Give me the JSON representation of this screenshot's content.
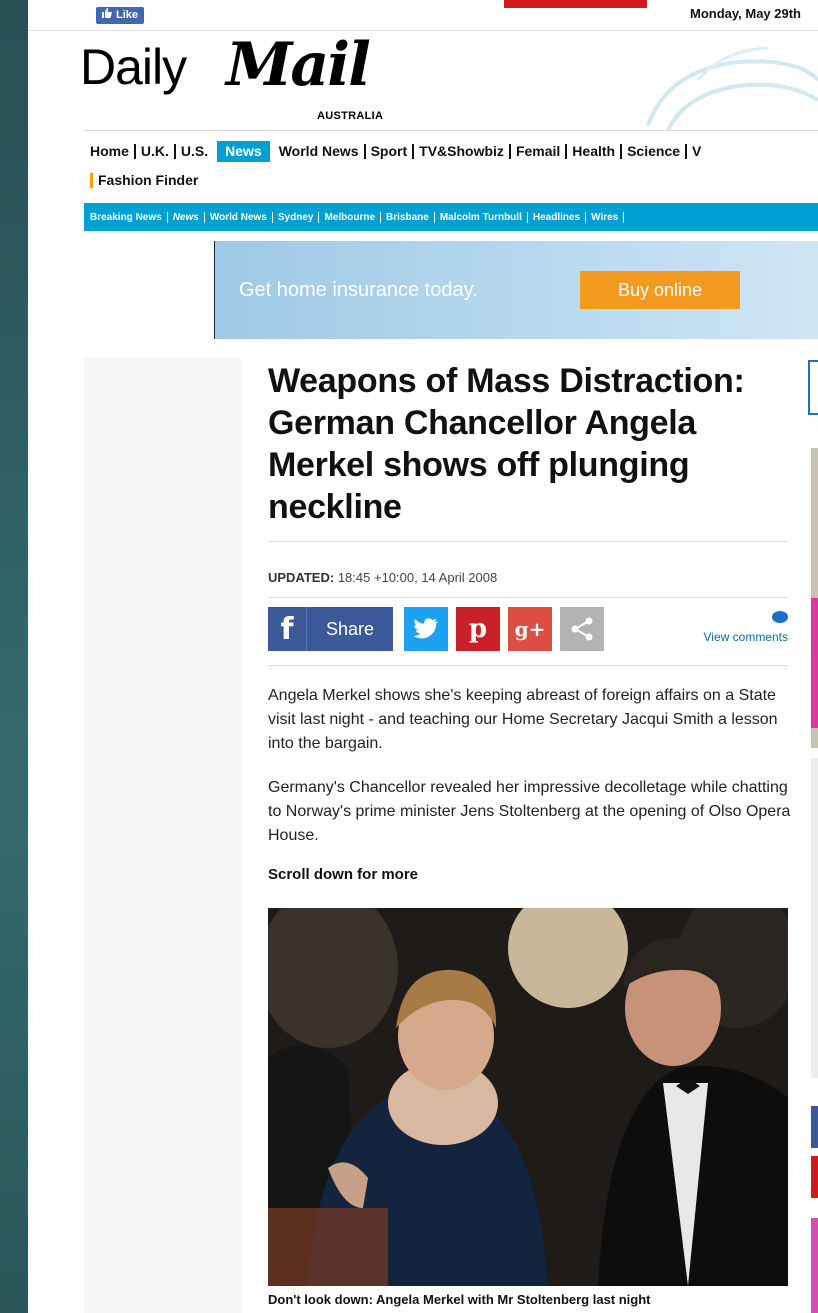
{
  "topbar": {
    "like_label": "Like",
    "date": "Monday, May 29th"
  },
  "masthead": {
    "logo_daily": "Daily",
    "logo_mail": "Mail",
    "edition": "AUSTRALIA"
  },
  "nav": {
    "primary": [
      "Home",
      "U.K.",
      "U.S.",
      "News",
      "World News",
      "Sport",
      "TV&Showbiz",
      "Femail",
      "Health",
      "Science",
      "V"
    ],
    "active": "News",
    "secondary_row": "Fashion Finder"
  },
  "subnav": {
    "items": [
      "Breaking News",
      "News",
      "World News",
      "Sydney",
      "Melbourne",
      "Brisbane",
      "Malcolm Turnbull",
      "Headlines",
      "Wires"
    ]
  },
  "ad": {
    "text": "Get home insurance today.",
    "button": "Buy online"
  },
  "article": {
    "headline": "Weapons of Mass Distraction: German Chancellor Angela Merkel shows off plunging neckline",
    "updated_label": "UPDATED:",
    "updated_value": "18:45 +10:00, 14 April 2008",
    "share_label": "Share",
    "view_comments": "View comments",
    "paragraphs": [
      "Angela Merkel shows she's keeping abreast of foreign affairs on a State visit last night - and teaching our Home Secretary Jacqui Smith a lesson into the bargain.",
      "Germany's Chancellor revealed her impressive decolletage while chatting to Norway's prime minister Jens Stoltenberg at the opening of Olso Opera House."
    ],
    "scroll_note": "Scroll down for more",
    "caption": "Don't look down: Angela Merkel with Mr Stoltenberg last night"
  },
  "colors": {
    "nav_accent": "#00a0d2",
    "facebook": "#3b5998",
    "twitter": "#1da1f2",
    "pinterest": "#cb2027",
    "google_plus": "#dc4e41",
    "ad_button": "#f49b1f"
  },
  "icons": [
    "facebook-icon",
    "twitter-icon",
    "pinterest-icon",
    "google-plus-icon",
    "share-icon",
    "comment-bubble-icon",
    "thumbs-up-icon"
  ]
}
